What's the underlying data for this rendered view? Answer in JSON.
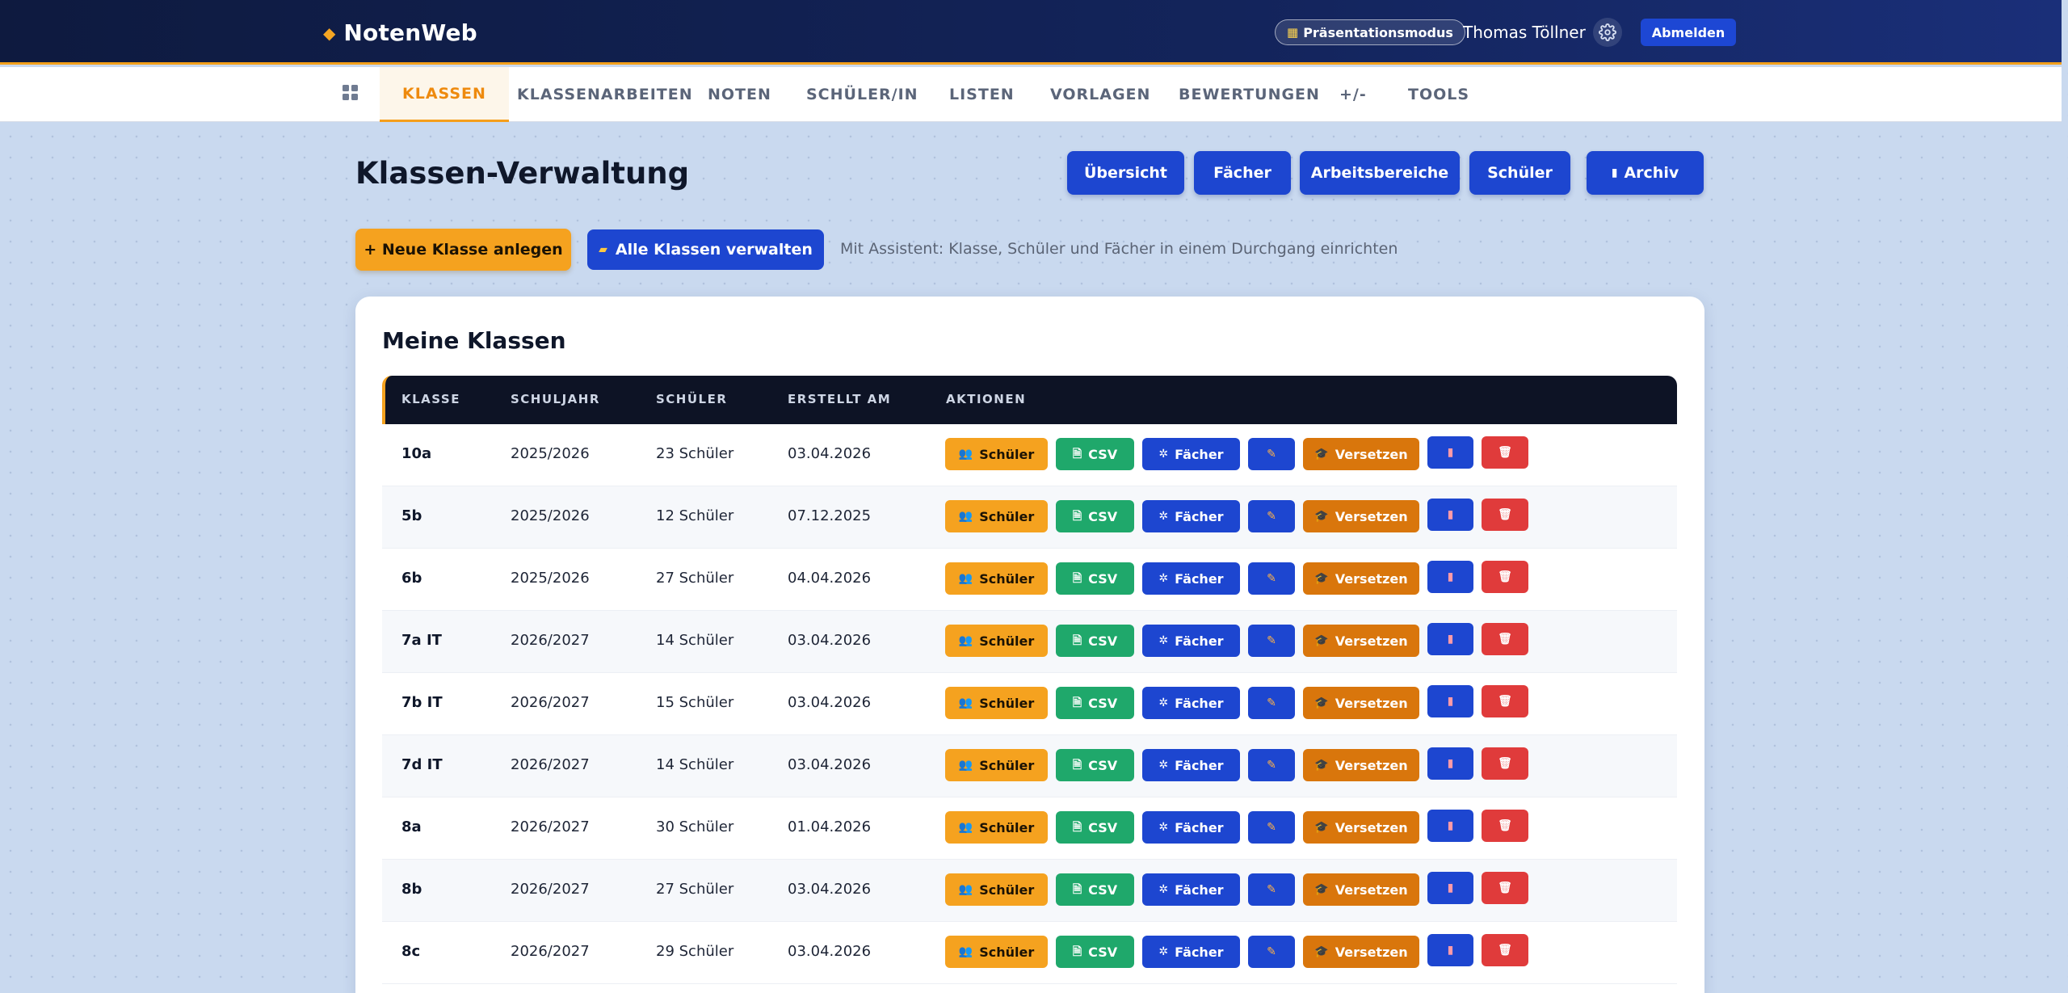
{
  "brand": {
    "name": "NotenWeb",
    "icon": "diamond-icon",
    "accent": "#f5a623"
  },
  "topbar": {
    "presentation_label": "Präsentationsmodus",
    "user_name": "Thomas Töllner",
    "logout_label": "Abmelden"
  },
  "nav": {
    "tabs": [
      {
        "label": "KLASSEN",
        "active": true
      },
      {
        "label": "KLASSENARBEITEN",
        "active": false
      },
      {
        "label": "NOTEN",
        "active": false
      },
      {
        "label": "SCHÜLER/IN",
        "active": false
      },
      {
        "label": "LISTEN",
        "active": false
      },
      {
        "label": "VORLAGEN",
        "active": false
      },
      {
        "label": "BEWERTUNGEN",
        "active": false
      },
      {
        "label": "+/-",
        "active": false
      },
      {
        "label": "TOOLS",
        "active": false
      }
    ]
  },
  "header": {
    "title": "Klassen-Verwaltung",
    "buttons": [
      "Übersicht",
      "Fächer",
      "Arbeitsbereiche",
      "Schüler",
      "Archiv"
    ]
  },
  "actions": {
    "new_class": "+ Neue Klasse anlegen",
    "manage_all": "Alle Klassen verwalten",
    "hint": "Mit Assistent: Klasse, Schüler und Fächer in einem Durchgang einrichten"
  },
  "table": {
    "title": "Meine Klassen",
    "columns": [
      "KLASSE",
      "SCHULJAHR",
      "SCHÜLER",
      "ERSTELLT AM",
      "AKTIONEN"
    ],
    "rows": [
      {
        "klasse": "10a",
        "schuljahr": "2025/2026",
        "schueler": "23 Schüler",
        "erstellt": "03.04.2026"
      },
      {
        "klasse": "5b",
        "schuljahr": "2025/2026",
        "schueler": "12 Schüler",
        "erstellt": "07.12.2025"
      },
      {
        "klasse": "6b",
        "schuljahr": "2025/2026",
        "schueler": "27 Schüler",
        "erstellt": "04.04.2026"
      },
      {
        "klasse": "7a IT",
        "schuljahr": "2026/2027",
        "schueler": "14 Schüler",
        "erstellt": "03.04.2026"
      },
      {
        "klasse": "7b IT",
        "schuljahr": "2026/2027",
        "schueler": "15 Schüler",
        "erstellt": "03.04.2026"
      },
      {
        "klasse": "7d IT",
        "schuljahr": "2026/2027",
        "schueler": "14 Schüler",
        "erstellt": "03.04.2026"
      },
      {
        "klasse": "8a",
        "schuljahr": "2026/2027",
        "schueler": "30 Schüler",
        "erstellt": "01.04.2026"
      },
      {
        "klasse": "8b",
        "schuljahr": "2026/2027",
        "schueler": "27 Schüler",
        "erstellt": "03.04.2026"
      },
      {
        "klasse": "8c",
        "schuljahr": "2026/2027",
        "schueler": "29 Schüler",
        "erstellt": "03.04.2026"
      }
    ],
    "row_actions": {
      "schueler": "Schüler",
      "csv": "CSV",
      "faecher": "Fächer",
      "versetzen": "Versetzen"
    }
  },
  "colors": {
    "navy": "#0e1a3f",
    "primary": "#1d46d0",
    "orange": "#f5a21f",
    "green": "#1fa86b",
    "red": "#e03b3b"
  }
}
